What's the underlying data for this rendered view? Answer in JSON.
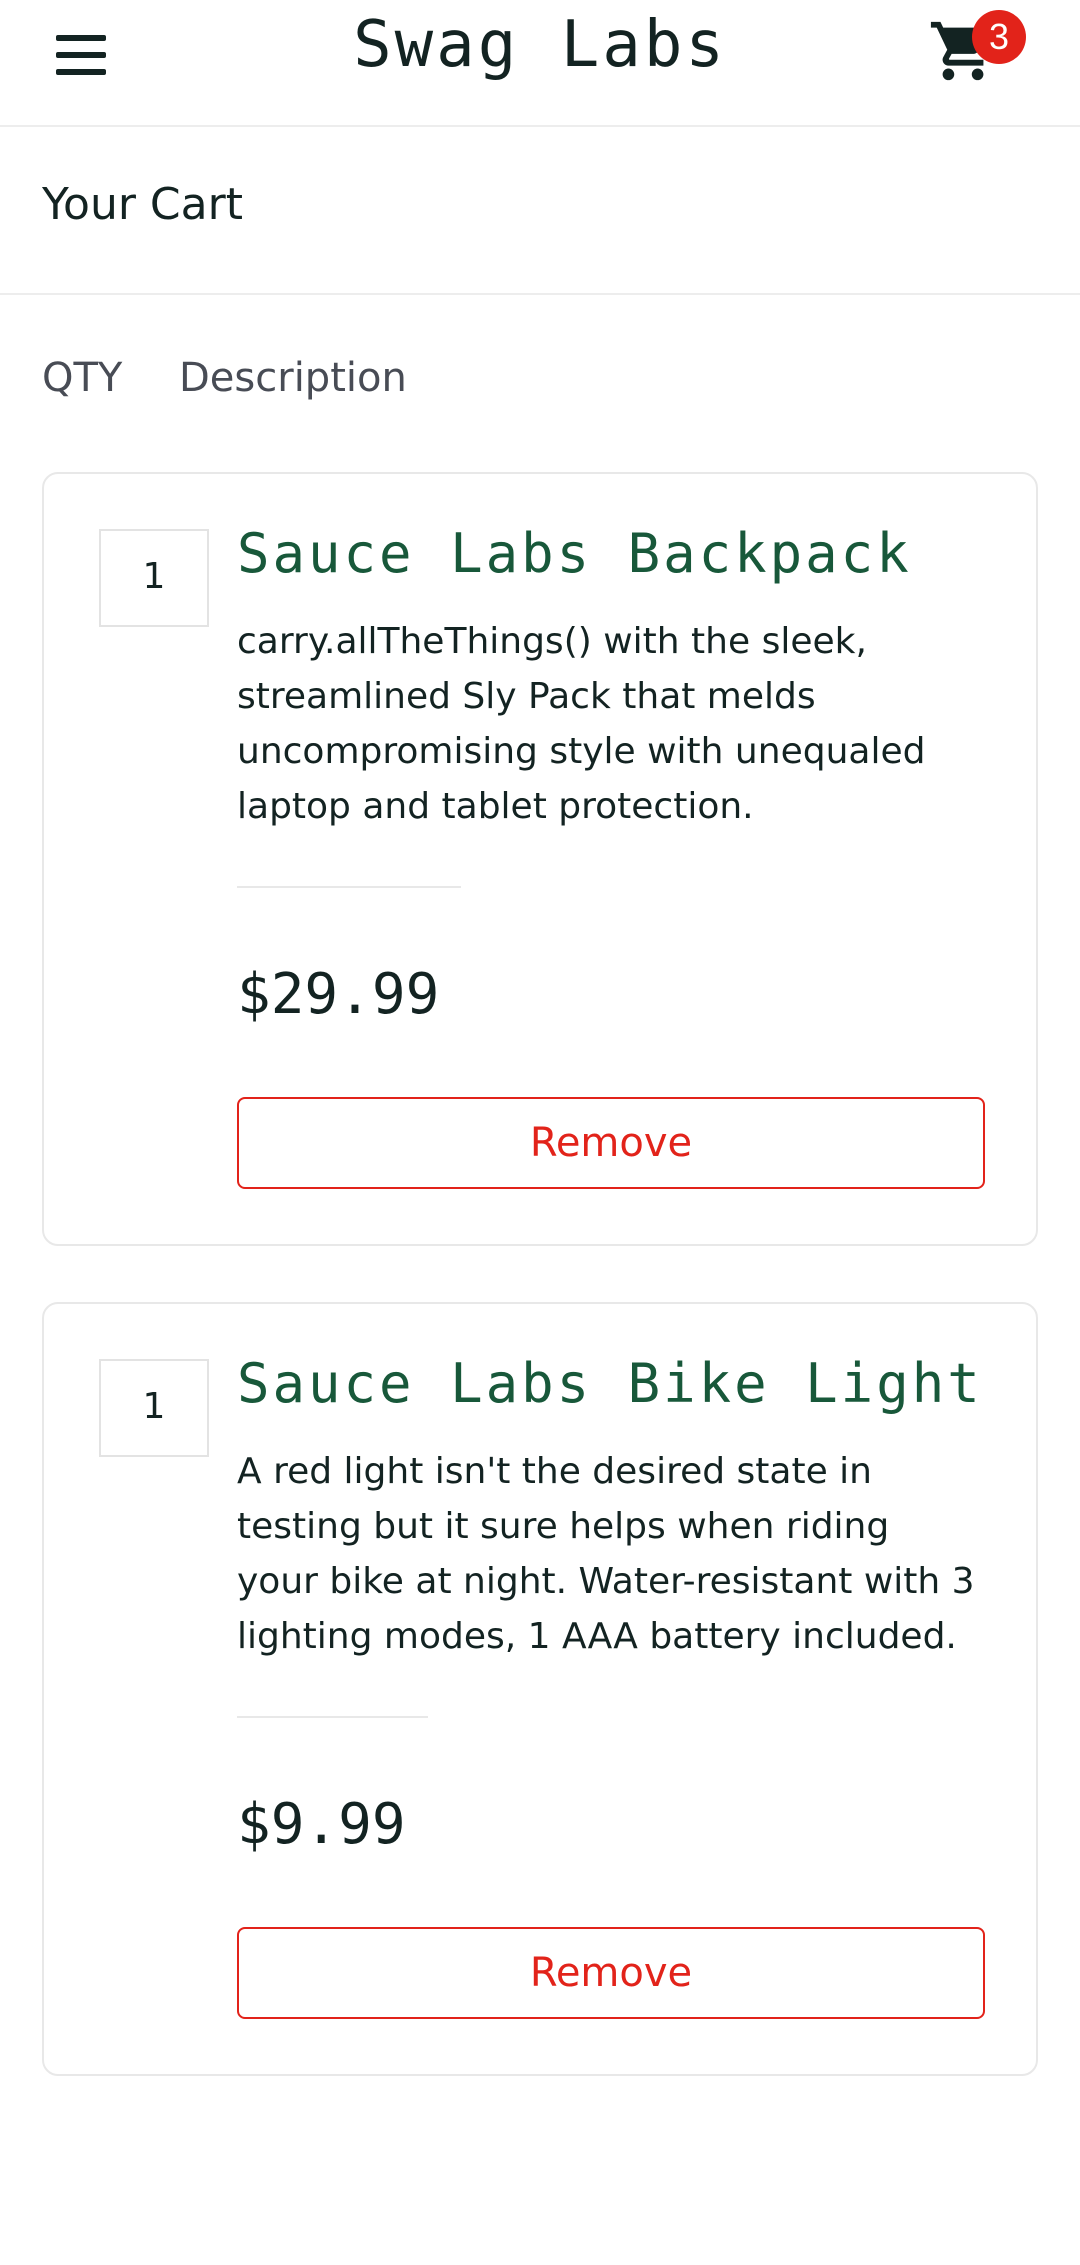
{
  "header": {
    "menu_icon": "hamburger-menu-icon",
    "title": "Swag Labs",
    "cart_icon": "shopping-cart-icon",
    "cart_count": "3",
    "badge_color": "#e2231a"
  },
  "page": {
    "title": "Your Cart"
  },
  "columns": {
    "qty": "QTY",
    "description": "Description"
  },
  "cart_items": [
    {
      "quantity": "1",
      "name": "Sauce Labs Backpack",
      "description": "carry.allTheThings() with the sleek, streamlined Sly Pack that melds uncompromising style with unequaled laptop and tablet protection.",
      "price": "$29.99",
      "remove_label": "Remove"
    },
    {
      "quantity": "1",
      "name": "Sauce Labs Bike Light",
      "description": "A red light isn't the desired state in testing but it sure helps when riding your bike at night. Water-resistant with 3 lighting modes, 1 AAA battery included.",
      "price": "$9.99",
      "remove_label": "Remove"
    }
  ],
  "colors": {
    "item_name": "#18583a",
    "remove": "#e2231a",
    "text": "#132322"
  }
}
